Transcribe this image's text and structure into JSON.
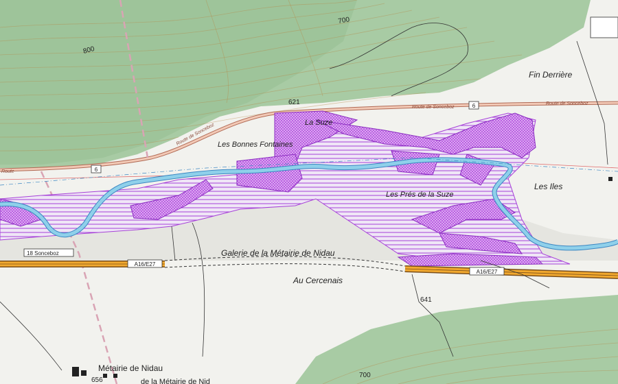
{
  "map": {
    "place_labels": {
      "fin_derriere": "Fin Derrière",
      "les_bonnes_fontaines": "Les Bonnes Fontaines",
      "les_iles": "Les Iles",
      "les_pres_de_la_suze": "Les Prés de la Suze",
      "galerie": "Galerie de la Métairie de Nidau",
      "au_cercenais": "Au Cercenais",
      "metairie_de_nidau": "Métairie de Nidau",
      "metairie_partial": "de la Métairie de Nid",
      "river": "La Suze"
    },
    "elevations": {
      "e800": "800",
      "e700_top": "700",
      "e700_bottom": "700",
      "e621": "621",
      "e641": "641",
      "e656": "656"
    },
    "road_badges": {
      "route6_left": "6",
      "route6_right": "6",
      "motorway_left": "A16/E27",
      "motorway_right": "A16/E27"
    },
    "road_names": {
      "route_de_sonceboz_1": "Route de Sonceboz",
      "route_de_sonceboz_2": "Route de Sonceboz",
      "route_de_sonceboz_3": "Route de Sonceboz",
      "route_left": "Route"
    },
    "exit_sign": "18 Sonceboz",
    "colors": {
      "forest": "#9fc49c",
      "open_land": "#f2f2ee",
      "river": "#7fc9e6",
      "protected_area": "#a640d8",
      "motorway": "#f2a92f",
      "main_road": "#e4a58f"
    }
  }
}
